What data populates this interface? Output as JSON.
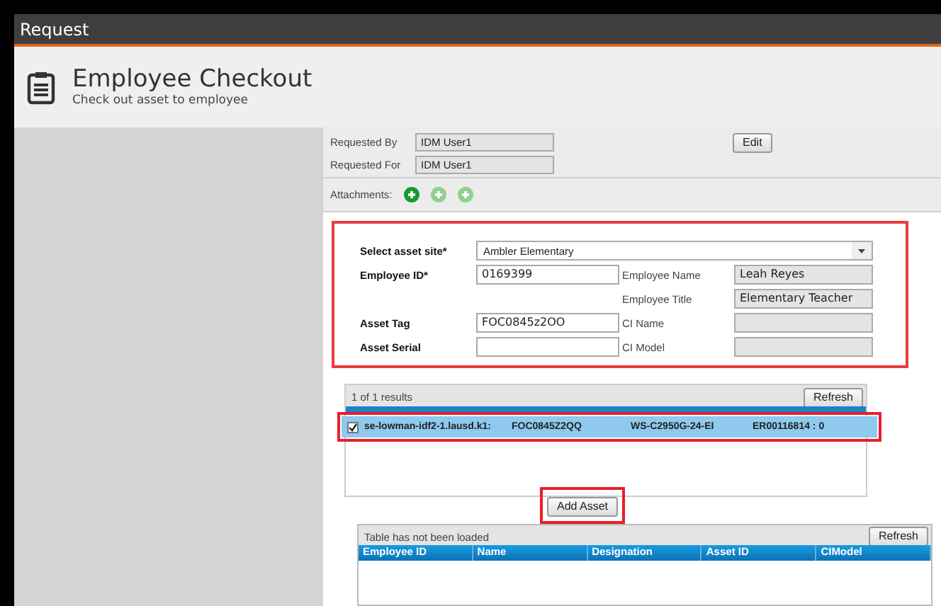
{
  "window": {
    "title": "Request"
  },
  "header": {
    "title": "Employee Checkout",
    "subtitle": "Check out asset to employee"
  },
  "request_info": {
    "fields": [
      {
        "label": "Requested By",
        "value": "IDM User1"
      },
      {
        "label": "Requested For",
        "value": "IDM User1"
      }
    ],
    "edit_button": "Edit"
  },
  "attachments": {
    "label": "Attachments:",
    "buttons": [
      {
        "disabled": false
      },
      {
        "disabled": true
      },
      {
        "disabled": true
      }
    ]
  },
  "asset_form": {
    "highlighted": true,
    "site": {
      "label": "Select asset site*",
      "value": "Ambler Elementary"
    },
    "employee_id": {
      "label": "Employee ID*",
      "value": "0169399"
    },
    "asset_tag": {
      "label": "Asset Tag",
      "value": "FOC0845z2OO"
    },
    "asset_serial": {
      "label": "Asset Serial"
    },
    "info_fields": [
      {
        "label": "Employee Name",
        "value": "Leah Reyes"
      },
      {
        "label": "Employee Title",
        "value": "Elementary Teacher"
      },
      {
        "label": "CI Name"
      },
      {
        "label": "CI Model"
      }
    ]
  },
  "results": {
    "count": "1 of 1 results",
    "refresh": "Refresh",
    "rows": [
      {
        "checked": true,
        "selected": true,
        "highlighted": true,
        "cells": [
          "se-lowman-idf2-1.lausd.k1:",
          "FOC0845Z2QQ",
          "WS-C2950G-24-EI",
          "ER00116814 : 0"
        ]
      }
    ]
  },
  "add_asset": {
    "label": "Add Asset",
    "highlighted": true
  },
  "assets_table": {
    "status": "Table has not been loaded",
    "refresh": "Refresh",
    "columns": [
      "Employee ID",
      "Name",
      "Designation",
      "Asset ID",
      "CIModel"
    ]
  }
}
